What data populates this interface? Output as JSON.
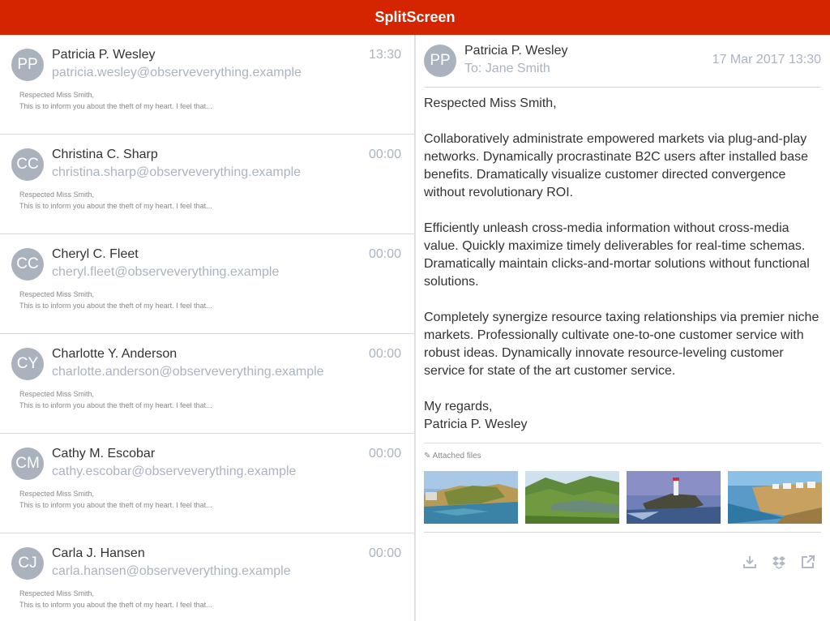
{
  "app": {
    "title": "SplitScreen"
  },
  "messages": [
    {
      "initials": "PP",
      "name": "Patricia P. Wesley",
      "email": "patricia.wesley@observeverything.example",
      "time": "13:30",
      "greeting": "Respected Miss Smith,",
      "snippet": "This is to inform you about the theft of my heart. I feel that..."
    },
    {
      "initials": "CC",
      "name": "Christina C. Sharp",
      "email": "christina.sharp@observeverything.example",
      "time": "00:00",
      "greeting": "Respected Miss Smith,",
      "snippet": "This is to inform you about the theft of my heart. I feel that..."
    },
    {
      "initials": "CC",
      "name": "Cheryl C. Fleet",
      "email": "cheryl.fleet@observeverything.example",
      "time": "00:00",
      "greeting": "Respected Miss Smith,",
      "snippet": "This is to inform you about the theft of my heart. I feel that..."
    },
    {
      "initials": "CY",
      "name": "Charlotte Y. Anderson",
      "email": "charlotte.anderson@observeverything.example",
      "time": "00:00",
      "greeting": "Respected Miss Smith,",
      "snippet": "This is to inform you about the theft of my heart. I feel that..."
    },
    {
      "initials": "CM",
      "name": "Cathy M. Escobar",
      "email": "cathy.escobar@observeverything.example",
      "time": "00:00",
      "greeting": "Respected Miss Smith,",
      "snippet": "This is to inform you about the theft of my heart. I feel that..."
    },
    {
      "initials": "CJ",
      "name": "Carla J. Hansen",
      "email": "carla.hansen@observeverything.example",
      "time": "00:00",
      "greeting": "Respected Miss Smith,",
      "snippet": "This is to inform you about the theft of my heart. I feel that..."
    }
  ],
  "detail": {
    "initials": "PP",
    "from": "Patricia P. Wesley",
    "to": "To: Jane Smith",
    "date": "17 Mar 2017 13:30",
    "greeting": "Respected Miss Smith,",
    "paragraphs": [
      "Collaboratively administrate empowered markets via plug-and-play networks. Dynamically procrastinate B2C users after installed base benefits. Dramatically visualize customer directed convergence without revolutionary ROI.",
      "Efficiently unleash cross-media information without cross-media value. Quickly maximize timely deliverables for real-time schemas. Dramatically maintain clicks-and-mortar solutions without functional solutions.",
      "Completely synergize resource taxing relationships via premier niche markets. Professionally cultivate one-to-one customer service with robust ideas. Dynamically innovate resource-leveling customer service for state of the art customer service."
    ],
    "closing": "My regards,",
    "signature": "Patricia P. Wesley",
    "attachments_label": "✎ Attached files",
    "attachments": [
      {
        "icon": "coastal-bay-photo"
      },
      {
        "icon": "river-valley-photo"
      },
      {
        "icon": "lighthouse-cliff-photo"
      },
      {
        "icon": "cliff-village-photo"
      }
    ],
    "actions": [
      {
        "icon": "download-icon"
      },
      {
        "icon": "dropbox-icon"
      },
      {
        "icon": "external-link-icon"
      }
    ]
  },
  "colors": {
    "accent": "#d52500",
    "avatar": "#a9b2bd",
    "muted": "#aab4c0"
  }
}
